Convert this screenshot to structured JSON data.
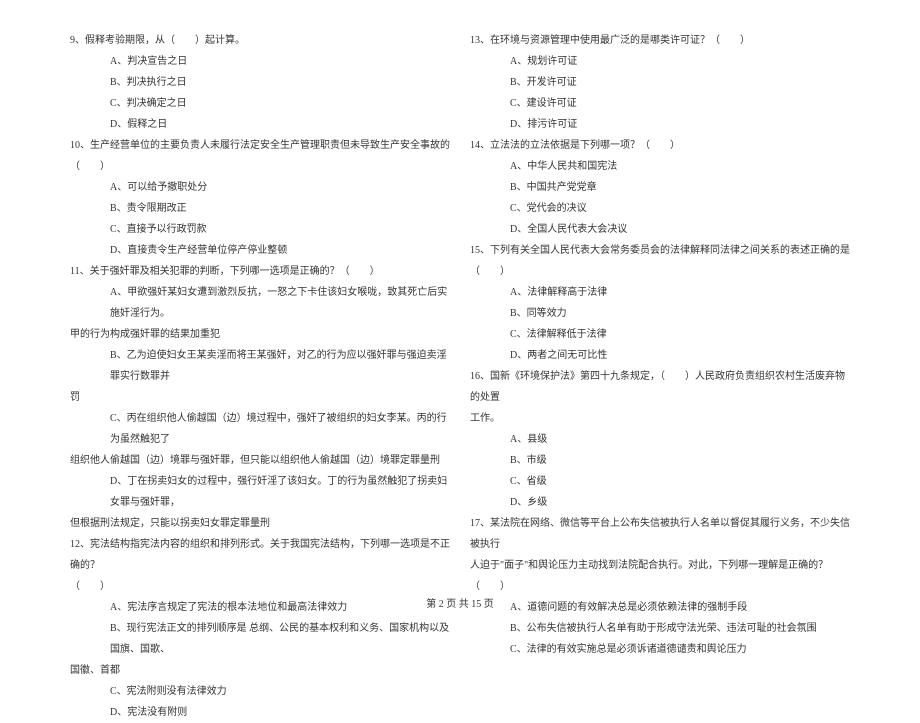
{
  "left": {
    "q9": "9、假释考验期限，从（　　）起计算。",
    "q9a": "A、判决宣告之日",
    "q9b": "B、判决执行之日",
    "q9c": "C、判决确定之日",
    "q9d": "D、假释之日",
    "q10": "10、生产经营单位的主要负责人未履行法定安全生产管理职责但未导致生产安全事故的（　　）",
    "q10a": "A、可以给予撤职处分",
    "q10b": "B、责令限期改正",
    "q10c": "C、直接予以行政罚款",
    "q10d": "D、直接责令生产经营单位停产停业整顿",
    "q11": "11、关于强奸罪及相关犯罪的判断，下列哪一选项是正确的？（　　）",
    "q11a": "A、甲欲强奸某妇女遭到激烈反抗，一怒之下卡住该妇女喉咙，致其死亡后实施奸淫行为。",
    "q11a2": "甲的行为构成强奸罪的结果加重犯",
    "q11b": "B、乙为迫使妇女王某卖淫而将王某强奸，对乙的行为应以强奸罪与强迫卖淫罪实行数罪并",
    "q11b2": "罚",
    "q11c": "C、丙在组织他人偷越国（边）境过程中，强奸了被组织的妇女李某。丙的行为虽然触犯了",
    "q11c2": "组织他人偷越国（边）境罪与强奸罪，但只能以组织他人偷越国（边）境罪定罪量刑",
    "q11d": "D、丁在拐卖妇女的过程中，强行奸淫了该妇女。丁的行为虽然触犯了拐卖妇女罪与强奸罪，",
    "q11d2": "但根据刑法规定，只能以拐卖妇女罪定罪量刑",
    "q12": "12、宪法结构指宪法内容的组织和排列形式。关于我国宪法结构，下列哪一选项是不正确的？",
    "q12b": "（　　）",
    "q12a1": "A、宪法序言规定了宪法的根本法地位和最高法律效力",
    "q12a2": "B、现行宪法正文的排列顺序是 总纲、公民的基本权利和义务、国家机构以及国旗、国歌、",
    "q12a2b": "国徽、首都",
    "q12a3": "C、宪法附则没有法律效力",
    "q12a4": "D、宪法没有附则"
  },
  "right": {
    "q13": "13、在环境与资源管理中使用最广泛的是哪类许可证？（　　）",
    "q13a": "A、规划许可证",
    "q13b": "B、开发许可证",
    "q13c": "C、建设许可证",
    "q13d": "D、排污许可证",
    "q14": "14、立法法的立法依据是下列哪一项？（　　）",
    "q14a": "A、中华人民共和国宪法",
    "q14b": "B、中国共产党党章",
    "q14c": "C、党代会的决议",
    "q14d": "D、全国人民代表大会决议",
    "q15": "15、下列有关全国人民代表大会常务委员会的法律解释同法律之间关系的表述正确的是（　　）",
    "q15a": "A、法律解释高于法律",
    "q15b": "B、同等效力",
    "q15c": "C、法律解释低于法律",
    "q15d": "D、两者之间无可比性",
    "q16": "16、国新《环境保护法》第四十九条规定，（　　）人民政府负责组织农村生活废弃物的处置",
    "q16b": "工作。",
    "q16a1": "A、县级",
    "q16a2": "B、市级",
    "q16a3": "C、省级",
    "q16a4": "D、乡级",
    "q17": "17、某法院在网络、微信等平台上公布失信被执行人名单以督促其履行义务，不少失信被执行",
    "q17b": "人迫于\"面子\"和舆论压力主动找到法院配合执行。对此，下列哪一理解是正确的？（　　）",
    "q17a1": "A、道德问题的有效解决总是必须依赖法律的强制手段",
    "q17a2": "B、公布失信被执行人名单有助于形成守法光荣、违法可耻的社会氛围",
    "q17a3": "C、法律的有效实施总是必须诉诸道德谴责和舆论压力"
  },
  "footer": "第 2 页 共 15 页"
}
